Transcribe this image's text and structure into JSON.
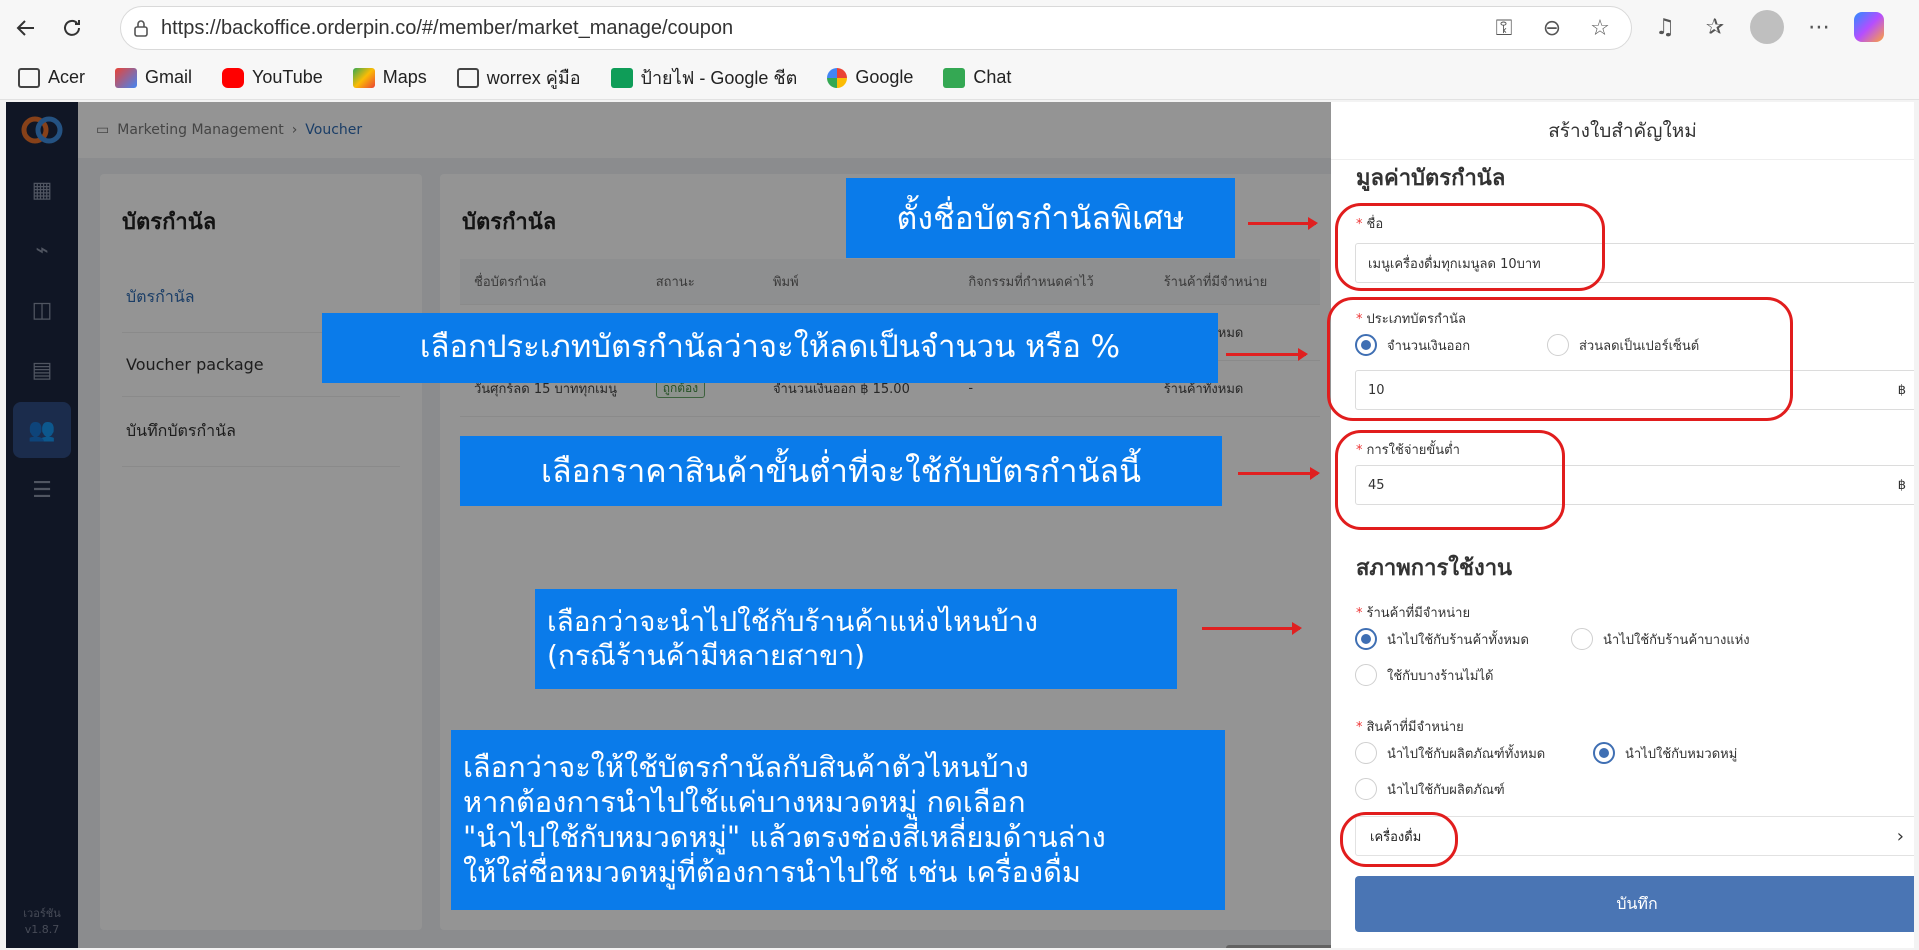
{
  "browser": {
    "url": "https://backoffice.orderpin.co/#/member/market_manage/coupon",
    "bookmarks": [
      "Acer",
      "Gmail",
      "YouTube",
      "Maps",
      "worrex คู่มือ",
      "ป้ายไฟ - Google ชีต",
      "Google",
      "Chat"
    ]
  },
  "app": {
    "breadcrumb": [
      "Marketing Management",
      "Voucher"
    ],
    "version": [
      "เวอร์ชัน",
      "v1.8.7"
    ],
    "left_card": {
      "title": "บัตรกำนัล",
      "items": [
        "บัตรกำนัล",
        "Voucher package",
        "บันทึกบัตรกำนัล"
      ]
    },
    "main_card": {
      "title": "บัตรกำนัล",
      "columns": [
        "ชื่อบัตรกำนัล",
        "สถานะ",
        "พิมพ์",
        "กิจกรรมที่กำหนดค่าไว้",
        "ร้านค้าที่มีจำหน่าย"
      ],
      "rows": [
        {
          "name": "",
          "status": "",
          "type": "",
          "activity": "",
          "store": "ร้านค้าทั้งหมด"
        },
        {
          "name": "วันศุกร์ลด 15 บาททุกเมนู",
          "status": "ถูกต้อง",
          "type": "จำนวนเงินออก ฿ 15.00",
          "activity": "-",
          "store": "ร้านค้าทั้งหมด"
        }
      ]
    }
  },
  "drawer": {
    "title": "สร้างใบสำคัญใหม่",
    "section_value": "มูลค่าบัตรกำนัล",
    "name_label": "ชื่อ",
    "name_value": "เมนูเครื่องดื่มทุกเมนูลด 10บาท",
    "type_label": "ประเภทบัตรกำนัล",
    "type_opt1": "จำนวนเงินออก",
    "type_opt2": "ส่วนลดเป็นเปอร์เซ็นต์",
    "amount_value": "10",
    "currency": "฿",
    "min_label": "การใช้จ่ายขั้นต่ำ",
    "min_value": "45",
    "section_usage": "สภาพการใช้งาน",
    "store_label": "ร้านค้าที่มีจำหน่าย",
    "store_opt1": "นำไปใช้กับร้านค้าทั้งหมด",
    "store_opt2": "นำไปใช้กับร้านค้าบางแห่ง",
    "store_opt3": "ใช้กับบางร้านไม่ได้",
    "product_label": "สินค้าที่มีจำหน่าย",
    "product_opt1": "นำไปใช้กับผลิตภัณฑ์ทั้งหมด",
    "product_opt2": "นำไปใช้กับหมวดหมู่",
    "product_opt3": "นำไปใช้กับผลิตภัณฑ์",
    "category_value": "เครื่องดื่ม",
    "submit": "บันทึก"
  },
  "annotations": {
    "a1": "ตั้งชื่อบัตรกำนัลพิเศษ",
    "a2": "เลือกประเภทบัตรกำนัลว่าจะให้ลดเป็นจำนวน หรือ %",
    "a3": "เลือกราคาสินค้าขั้นต่ำที่จะใช้กับบัตรกำนัลนี้",
    "a4_line1": "เลือกว่าจะนำไปใช้กับร้านค้าแห่งไหนบ้าง",
    "a4_line2": "(กรณีร้านค้ามีหลายสาขา)",
    "a5_line1": "เลือกว่าจะให้ใช้บัตรกำนัลกับสินค้าตัวไหนบ้าง",
    "a5_line2": "หากต้องการนำไปใช้แค่บางหมวดหมู่ กดเลือก",
    "a5_line3": "\"นำไปใช้กับหมวดหมู่\" แล้วตรงช่องสี่เหลี่ยมด้านล่าง",
    "a5_line4": "ให้ใส่ชื่อหมวดหมู่ที่ต้องการนำไปใช้ เช่น เครื่องดื่ม"
  },
  "colors": {
    "accent": "#4a75b4",
    "sidebar": "#1d2740",
    "annotation": "#0a7bea",
    "highlight": "#e11d1d"
  }
}
